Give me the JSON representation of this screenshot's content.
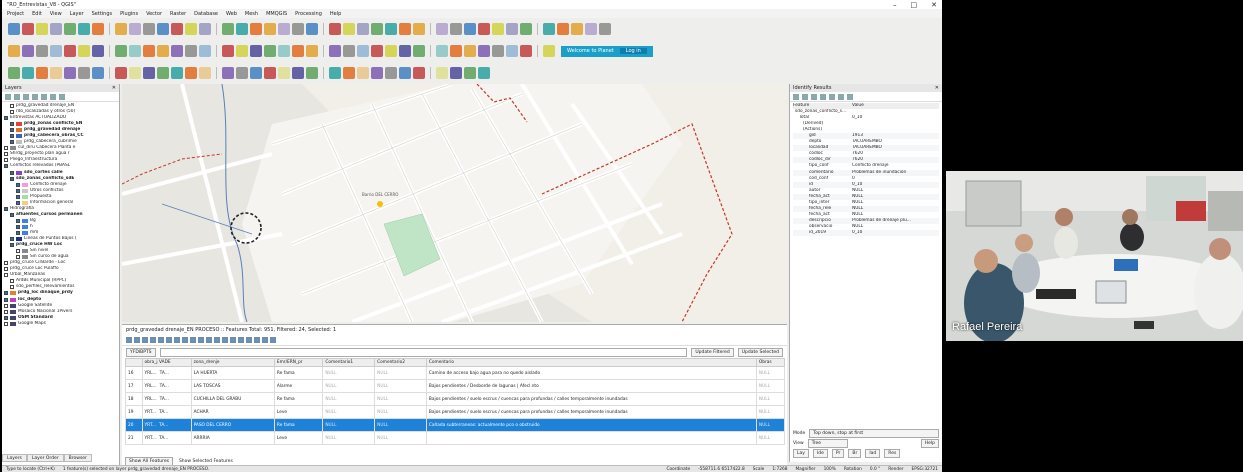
{
  "window": {
    "title": "\"RO_Entrevistas_V8 - QGIS\""
  },
  "menu": [
    "Project",
    "Edit",
    "View",
    "Layer",
    "Settings",
    "Plugins",
    "Vector",
    "Raster",
    "Database",
    "Web",
    "Mesh",
    "MMQGIS",
    "Processing",
    "Help"
  ],
  "toolbar": {
    "welcome_label": "Welcome to Planet",
    "welcome_btn": "Log in"
  },
  "layers_panel": {
    "title": "Layers",
    "items": [
      {
        "label": "prdg_gravedad drenaje_EN",
        "indent": 1,
        "bold": false,
        "checked": false,
        "swatch": ""
      },
      {
        "label": "rdo_localizadas y otros (50)",
        "indent": 1,
        "bold": false,
        "checked": false,
        "swatch": ""
      },
      {
        "label": "Entrevistas ACTUALIZADO",
        "indent": 0,
        "bold": false,
        "checked": true,
        "swatch": ""
      },
      {
        "label": "prdg_zonas conflicto_EN",
        "indent": 1,
        "bold": true,
        "checked": true,
        "swatch": "#e04040"
      },
      {
        "label": "prdg_gravedad drenaje",
        "indent": 1,
        "bold": true,
        "checked": true,
        "swatch": "#e07020"
      },
      {
        "label": "prdg_cabecera_obras_CC",
        "indent": 1,
        "bold": true,
        "checked": true,
        "swatch": "#4060c0"
      },
      {
        "label": "prdg_cabecera_cubrimie",
        "indent": 1,
        "bold": false,
        "checked": true,
        "swatch": "#c0c0c0"
      },
      {
        "label": "cul_diru Cabecera Planta e",
        "indent": 0,
        "bold": false,
        "checked": false,
        "swatch": "#888"
      },
      {
        "label": "Shrdg_proyecto plan agua r",
        "indent": 0,
        "bold": false,
        "checked": false,
        "swatch": ""
      },
      {
        "label": "Pliego_Infraestructura",
        "indent": 0,
        "bold": false,
        "checked": false,
        "swatch": ""
      },
      {
        "label": "Conflictos relevados (PBASL",
        "indent": 0,
        "bold": false,
        "checked": true,
        "swatch": ""
      },
      {
        "label": "sdo_cortes calle",
        "indent": 1,
        "bold": true,
        "checked": true,
        "swatch": "#9040c0"
      },
      {
        "label": "sdo_zonas_conflicto_sdE",
        "indent": 1,
        "bold": true,
        "checked": true,
        "swatch": ""
      },
      {
        "label": "Conflicto drenaje",
        "indent": 2,
        "bold": false,
        "checked": true,
        "swatch": "#f0a0d8"
      },
      {
        "label": "Otros conflictos",
        "indent": 2,
        "bold": false,
        "checked": true,
        "swatch": "#c8c8c8"
      },
      {
        "label": "Propuesta",
        "indent": 2,
        "bold": false,
        "checked": true,
        "swatch": "#a0e0a0"
      },
      {
        "label": "Informacion general",
        "indent": 2,
        "bold": false,
        "checked": true,
        "swatch": "#f0d080"
      },
      {
        "label": "Hidrografia",
        "indent": 0,
        "bold": false,
        "checked": true,
        "swatch": ""
      },
      {
        "label": "afluentes_cursos permanen",
        "indent": 1,
        "bold": true,
        "checked": true,
        "swatch": ""
      },
      {
        "label": "Bg",
        "indent": 2,
        "bold": false,
        "checked": true,
        "swatch": "#4080e0"
      },
      {
        "label": "h",
        "indent": 2,
        "bold": false,
        "checked": true,
        "swatch": "#4080e0"
      },
      {
        "label": "mm",
        "indent": 2,
        "bold": false,
        "checked": true,
        "swatch": "#4080e0"
      },
      {
        "label": "Lineas de Puntos Bajos (",
        "indent": 1,
        "bold": false,
        "checked": true,
        "swatch": "#203080"
      },
      {
        "label": "prdg_cruce HW Loc",
        "indent": 1,
        "bold": true,
        "checked": true,
        "swatch": ""
      },
      {
        "label": "Sin nivel",
        "indent": 2,
        "bold": false,
        "checked": false,
        "swatch": "#888"
      },
      {
        "label": "Sin curso de agua",
        "indent": 2,
        "bold": false,
        "checked": false,
        "swatch": "#888"
      },
      {
        "label": "prdg_cruce CirBarde - Loc",
        "indent": 0,
        "bold": false,
        "checked": false,
        "swatch": ""
      },
      {
        "label": "prdg_cruce Loc Pulaffo",
        "indent": 0,
        "bold": false,
        "checked": false,
        "swatch": ""
      },
      {
        "label": "Urbal_Manzanas",
        "indent": 0,
        "bold": false,
        "checked": false,
        "swatch": ""
      },
      {
        "label": "ArdBs Municipal (RPPC)",
        "indent": 1,
        "bold": false,
        "checked": false,
        "swatch": ""
      },
      {
        "label": "sdo_perfiles_relevamientos",
        "indent": 1,
        "bold": false,
        "checked": false,
        "swatch": ""
      },
      {
        "label": "prdg_loc dinaque_prdy",
        "indent": 0,
        "bold": true,
        "checked": true,
        "swatch": "#e08030"
      },
      {
        "label": "loc_depto",
        "indent": 0,
        "bold": true,
        "checked": true,
        "swatch": "#c040c0"
      },
      {
        "label": "Google Satellite",
        "indent": 0,
        "bold": false,
        "checked": false,
        "swatch": "#446"
      },
      {
        "label": "Mosaico Nacional 1Pivers",
        "indent": 0,
        "bold": false,
        "checked": false,
        "swatch": "#446"
      },
      {
        "label": "OSM Standard",
        "indent": 0,
        "bold": true,
        "checked": true,
        "swatch": "#446"
      },
      {
        "label": "Google Maps",
        "indent": 0,
        "bold": false,
        "checked": false,
        "swatch": "#446"
      }
    ],
    "tabs": [
      "Layers",
      "Layer Order",
      "Browser"
    ]
  },
  "map": {
    "label": "Barrio DEL CERRO"
  },
  "attr_table": {
    "title": "prdg_gravedad drenaje_EN PROCESO :: Features Total: 951, Filtered: 24, Selected: 1",
    "filter_field": "YFDIBPTS",
    "update_filtered": "Update Filtered",
    "update_selected": "Update Selected",
    "columns": [
      "obra_j VADE",
      "zona_drenje",
      "Emr/ERN_pr",
      "Comentario1",
      "Comentario2",
      "Comentario",
      "Obras"
    ],
    "rows": [
      {
        "n": "16",
        "c": [
          "YRL...",
          "TA...",
          "LA HUERTA",
          "Re fama",
          "NULL",
          "NULL",
          "Camino de acceso bajo agua para no quedo aislado",
          "NULL"
        ],
        "sel": false
      },
      {
        "n": "17",
        "c": [
          "YRL...",
          "TA...",
          "LAS TOSCAS",
          "Alarme",
          "NULL",
          "NULL",
          "Bajos pendientes / Desborde de lagunas | Afecl.nto",
          "NULL"
        ],
        "sel": false
      },
      {
        "n": "18",
        "c": [
          "YRL...",
          "TA...",
          "CUCHILLA DEL GRABU",
          "Re fama",
          "NULL",
          "NULL",
          "Bajos pendientes / suelo escrus / cuencas para profundas / calles temporalmente inundadas",
          "NULL"
        ],
        "sel": false
      },
      {
        "n": "19",
        "c": [
          "YRT...",
          "TA...",
          "ACHAR",
          "Leve",
          "NULL",
          "NULL",
          "Bajos pendientes / suelo escrus / cuencas para profundas / calles temporalmente inundadas",
          "NULL"
        ],
        "sel": false
      },
      {
        "n": "20",
        "c": [
          "YRT...",
          "TA...",
          "PASO DEL CERRO",
          "Re fama",
          "NULL",
          "NULL",
          "Cañada subterraneas: actualmente pco o obstruido",
          "NULL"
        ],
        "sel": true
      },
      {
        "n": "21",
        "c": [
          "YRT...",
          "TA...",
          "ARRRIA",
          "Leve",
          "NULL",
          "NULL",
          "",
          "NULL"
        ],
        "sel": false
      }
    ],
    "footer": "Show All Features",
    "footer_btn": "Show Selected Features"
  },
  "identify": {
    "title": "Identify Results",
    "col_feature": "Feature",
    "col_value": "Value",
    "tree": [
      {
        "k": "sdo_zonas_conflicto_s...",
        "v": ""
      },
      {
        "k": "Total",
        "v": "0_10"
      },
      {
        "k": "(Derived)",
        "v": ""
      },
      {
        "k": "(Actions)",
        "v": ""
      }
    ],
    "attrs": [
      {
        "k": "gid",
        "v": "1913"
      },
      {
        "k": "depto",
        "v": "TACUAREMBO"
      },
      {
        "k": "localidad",
        "v": "TACUAREMBO"
      },
      {
        "k": "codloc",
        "v": "7620"
      },
      {
        "k": "codloc_dir",
        "v": "7620"
      },
      {
        "k": "tipo_conf",
        "v": "Conflicto drenaje"
      },
      {
        "k": "comentario",
        "v": "Problemas de inundación"
      },
      {
        "k": "cod_conf",
        "v": "0"
      },
      {
        "k": "id",
        "v": "0_10"
      },
      {
        "k": "autor",
        "v": "NULL"
      },
      {
        "k": "fecha_act",
        "v": "NULL"
      },
      {
        "k": "tipo_inter",
        "v": "NULL"
      },
      {
        "k": "fecha_rele",
        "v": "NULL"
      },
      {
        "k": "fecha_act",
        "v": "NULL"
      },
      {
        "k": "descripcio",
        "v": "Problemas de drenaje plu..."
      },
      {
        "k": "observacio",
        "v": "NULL"
      },
      {
        "k": "id_2019",
        "v": "0_10"
      }
    ],
    "mode_label": "Mode",
    "mode_value": "Top down, stop at first",
    "view_label": "View",
    "view_value": "Tree",
    "help": "Help",
    "bottom_tabs": [
      "Lay",
      "Ide",
      "Pr",
      "Br",
      "Iad",
      "Res"
    ]
  },
  "statusbar": {
    "hint": "Type to locate (Ctrl+K)",
    "msg": "1 feature(s) selected on layer prdg_gravedad drenaje_EN PROCESO.",
    "coordinate_label": "Coordinate",
    "coordinate": "-558711.6 6517422.8",
    "scale_label": "Scale",
    "scale": "1:7268",
    "magnifier_label": "Magnifier",
    "magnifier": "100%",
    "rotation_label": "Rotation",
    "rotation": "0.0 °",
    "render": "Render",
    "crs": "EPSG:32721"
  },
  "video": {
    "name": "Rafael Pereira"
  }
}
